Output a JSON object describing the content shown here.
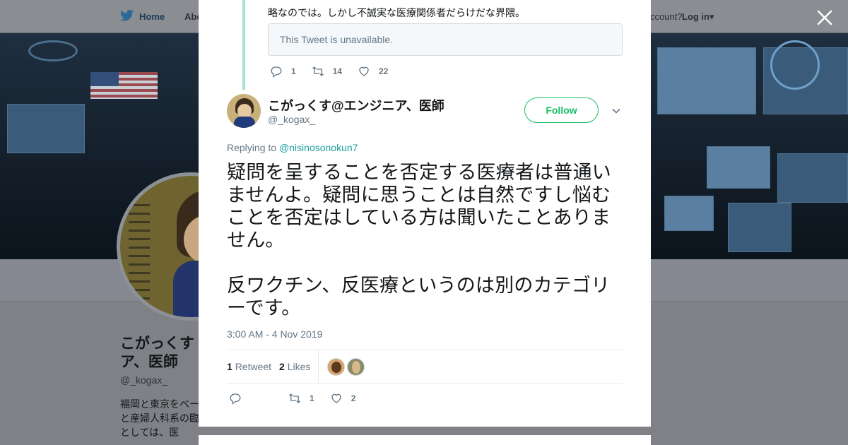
{
  "nav": {
    "home_label": "Home",
    "about_label": "Abo",
    "account_text": "ccount?",
    "login_label": "Log in"
  },
  "profile": {
    "name": "こがっくす ア、医師",
    "handle": "@_kogax_",
    "bio": "福岡と東京をベー ービス開発してま 開発と産婦人科系の臨床研究も。エンジ ニアとしては、医"
  },
  "parent_tweet": {
    "text_tail": "略なのでは。しかし不誠実な医療関係者だらけだな界隈。",
    "quote_unavailable": "This Tweet is unavailable.",
    "reply_count": "1",
    "retweet_count": "14",
    "like_count": "22"
  },
  "tweet": {
    "author_name": "こがっくす@エンジニア、医師",
    "author_handle": "@_kogax_",
    "follow_label": "Follow",
    "replying_to_prefix": "Replying to",
    "replying_to_handle": "@nisinosonokun7",
    "paragraph1": "疑問を呈することを否定する医療者は普通いませんよ。疑問に思うことは自然ですし悩むことを否定はしている方は聞いたことありません。",
    "paragraph2": "反ワクチン、反医療というのは別のカテゴリーです。",
    "timestamp": "3:00 AM - 4 Nov 2019",
    "retweets_number": "1",
    "retweets_label": "Retweet",
    "likes_number": "2",
    "likes_label": "Likes",
    "reply_count": "",
    "retweet_count": "1",
    "like_count": "2"
  },
  "colors": {
    "accent": "#17bf63",
    "link": "#1da1a0",
    "thread_line": "#a8e0cc",
    "muted": "#657786"
  },
  "icons": [
    "twitter-bird-icon",
    "close-icon",
    "reply-icon",
    "retweet-icon",
    "heart-icon",
    "chevron-down-icon"
  ]
}
